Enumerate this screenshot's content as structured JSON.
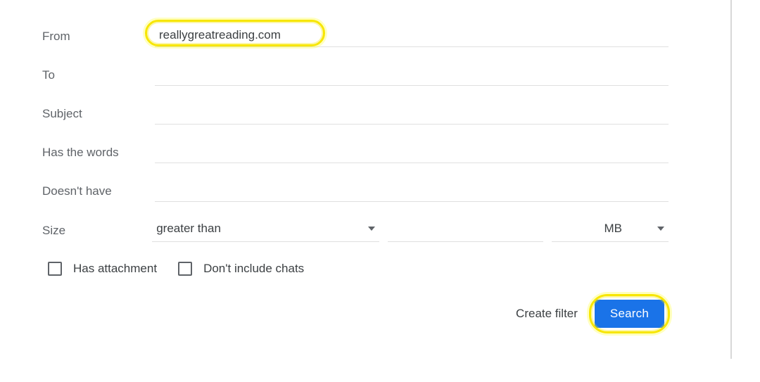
{
  "labels": {
    "from": "From",
    "to": "To",
    "subject": "Subject",
    "has_words": "Has the words",
    "doesnt_have": "Doesn't have",
    "size": "Size"
  },
  "values": {
    "from": "reallygreatreading.com",
    "to": "",
    "subject": "",
    "has_words": "",
    "doesnt_have": "",
    "size_amount": ""
  },
  "size_select": {
    "operator": "greater than",
    "unit": "MB"
  },
  "checkboxes": {
    "has_attachment": "Has attachment",
    "no_chats": "Don't include chats"
  },
  "actions": {
    "create_filter": "Create filter",
    "search": "Search"
  }
}
